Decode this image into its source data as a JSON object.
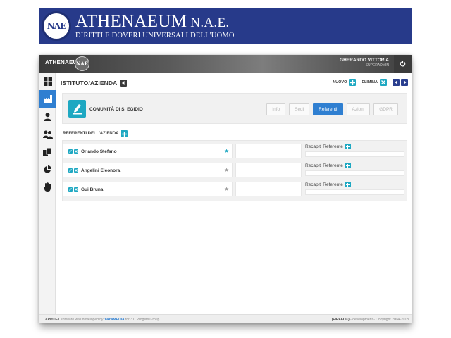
{
  "banner": {
    "logo_text": "NAE",
    "title_main": "ATHENAEUM",
    "title_suffix": " N.A.E.",
    "subtitle": "DIRITTI E DOVERI UNIVERSALI DELL'UOMO"
  },
  "topbar": {
    "brand": "ATHENAEUM",
    "brand_logo_text": "NAE",
    "user_name": "GHERARDO VITTORIA",
    "user_role": "SUPERADMIN",
    "power_icon": "power-icon"
  },
  "sidebar": {
    "items": [
      {
        "icon": "dashboard-grid-icon",
        "active": false
      },
      {
        "icon": "factory-icon",
        "active": true
      },
      {
        "icon": "user-icon",
        "active": false
      },
      {
        "icon": "users-group-icon",
        "active": false
      },
      {
        "icon": "copy-documents-icon",
        "active": false
      },
      {
        "icon": "pie-chart-icon",
        "active": false
      },
      {
        "icon": "hand-stop-icon",
        "active": false
      }
    ]
  },
  "header": {
    "title": "ISTITUTO/AZIENDA",
    "new_label": "NUOVO",
    "delete_label": "ELIMINA"
  },
  "company": {
    "name": "COMUNITÀ DI S. EGIDIO",
    "tabs": [
      {
        "label": "Info",
        "active": false
      },
      {
        "label": "Sedi",
        "active": false
      },
      {
        "label": "Referenti",
        "active": true
      },
      {
        "label": "Azioni",
        "active": false
      },
      {
        "label": "GDPR",
        "active": false
      }
    ]
  },
  "referents": {
    "section_title": "REFERENTI DELL'AZIENDA",
    "contacts_label": "Recapiti Referente",
    "rows": [
      {
        "name": "Orlando Stefano",
        "favorite": true
      },
      {
        "name": "Angelini Eleonora",
        "favorite": false
      },
      {
        "name": "Gui Bruna",
        "favorite": false
      }
    ]
  },
  "footer": {
    "app_name": "APPLIFT",
    "developed_text": " software was developed by ",
    "developer": "YAYAMEDIA",
    "for_text": " for 3TI Progetti Group",
    "browser": "(FIREFOX)",
    "env_text": " - development - ",
    "copyright": "Copyright 2004-2018"
  }
}
